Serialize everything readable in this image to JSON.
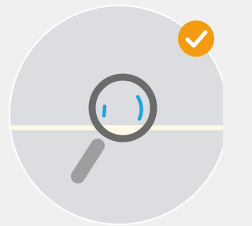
{
  "illustration": {
    "icon": "magnifier-icon",
    "subject": "hidden-item-search",
    "colors": {
      "page_bg": "#f0f0f0",
      "disc_fill": "#dcdde0",
      "disc_border": "#ffffff",
      "band": "#fdf9e6",
      "band_edge": "#f5f0d6",
      "lens_ring": "#6b6b6b",
      "lens_glass": "#dcdde0",
      "handle": "#9d9e9f",
      "lens_reveal": "#fdf9e6",
      "hidden_object": "#1ea3dd"
    }
  },
  "status_badge": {
    "icon": "checkmark-icon",
    "state": "completed",
    "colors": {
      "fill": "#f39c12",
      "mark": "#ffffff"
    }
  }
}
